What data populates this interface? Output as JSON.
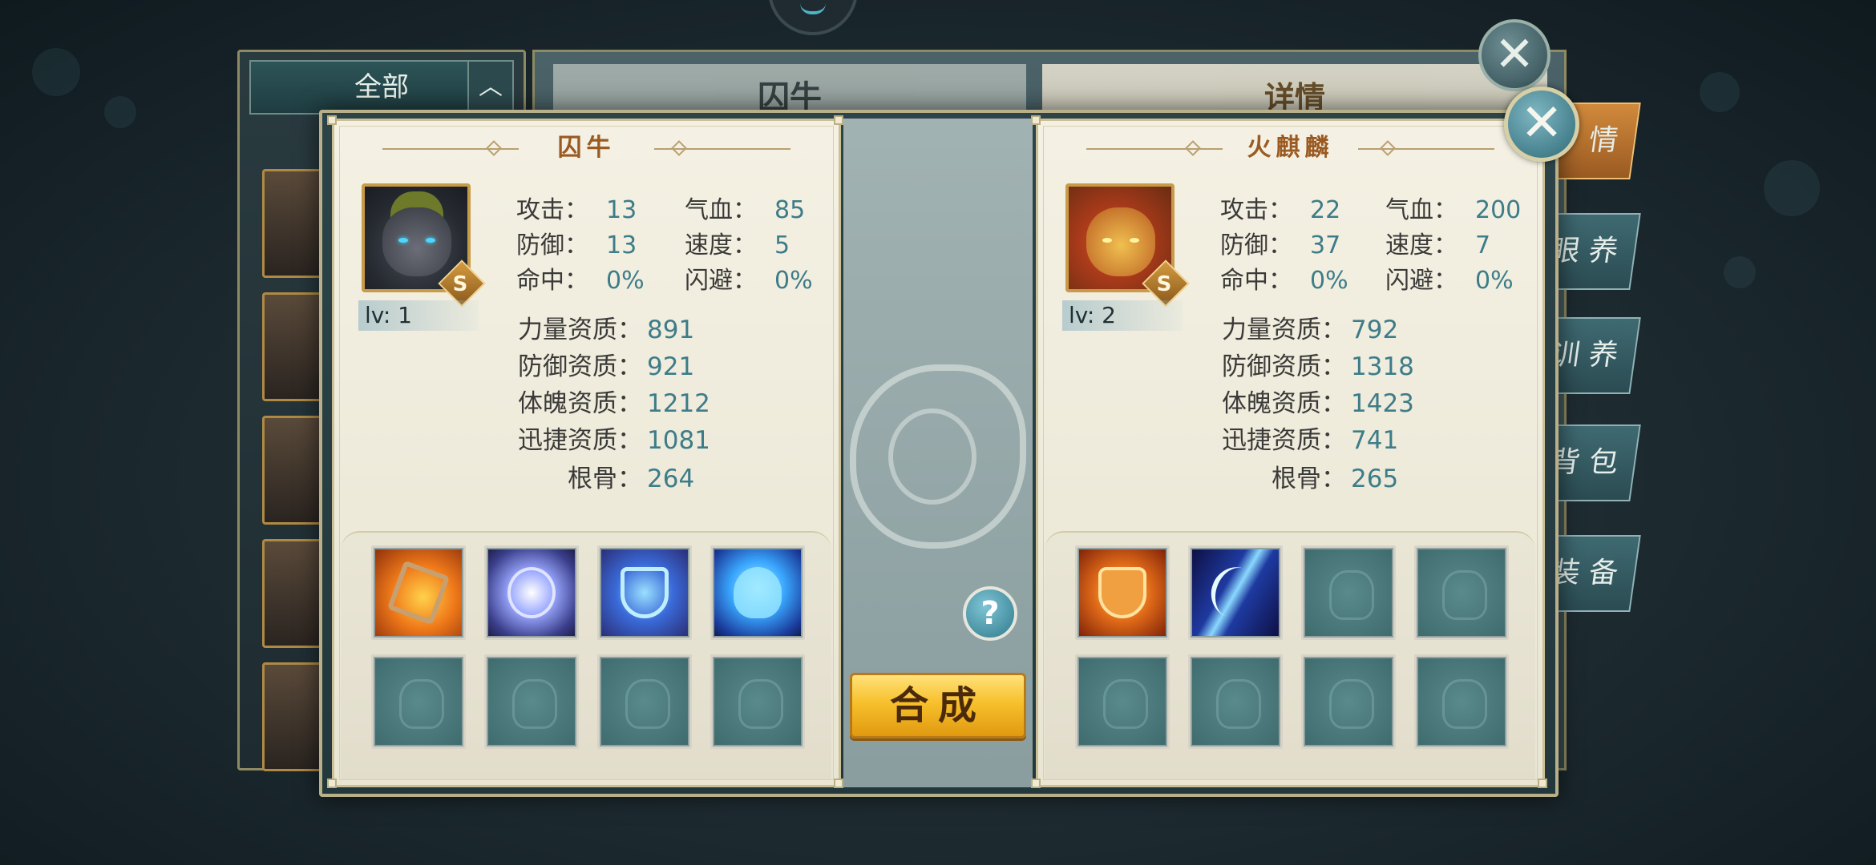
{
  "background": {
    "filter_label": "全部",
    "filter_arrow": "︿",
    "center_title": "囚牛",
    "detail_title": "详情",
    "side_tabs": [
      "情",
      "眼 养",
      "训 养",
      "背 包",
      "装 备"
    ]
  },
  "left_pet": {
    "name": "囚牛",
    "grade": "S",
    "level": "lv: 1",
    "stats": [
      {
        "label": "攻击：",
        "value": "13"
      },
      {
        "label": "气血：",
        "value": "85"
      },
      {
        "label": "防御：",
        "value": "13"
      },
      {
        "label": "速度：",
        "value": "5"
      },
      {
        "label": "命中：",
        "value": "0%"
      },
      {
        "label": "闪避：",
        "value": "0%"
      }
    ],
    "aptitudes": [
      {
        "label": "力量资质：",
        "value": "891"
      },
      {
        "label": "防御资质：",
        "value": "921"
      },
      {
        "label": "体魄资质：",
        "value": "1212"
      },
      {
        "label": "迅捷资质：",
        "value": "1081"
      },
      {
        "label": "根骨：",
        "value": "264"
      }
    ],
    "skills": [
      "fire-rune-skill-icon",
      "spirit-orb-skill-icon",
      "shield-skill-icon",
      "heart-skill-icon",
      "empty",
      "empty",
      "empty",
      "empty"
    ]
  },
  "right_pet": {
    "name": "火麒麟",
    "grade": "S",
    "level": "lv: 2",
    "stats": [
      {
        "label": "攻击：",
        "value": "22"
      },
      {
        "label": "气血：",
        "value": "200"
      },
      {
        "label": "防御：",
        "value": "37"
      },
      {
        "label": "速度：",
        "value": "7"
      },
      {
        "label": "命中：",
        "value": "0%"
      },
      {
        "label": "闪避：",
        "value": "0%"
      }
    ],
    "aptitudes": [
      {
        "label": "力量资质：",
        "value": "792"
      },
      {
        "label": "防御资质：",
        "value": "1318"
      },
      {
        "label": "体魄资质：",
        "value": "1423"
      },
      {
        "label": "迅捷资质：",
        "value": "741"
      },
      {
        "label": "根骨：",
        "value": "265"
      }
    ],
    "skills": [
      "flame-guard-skill-icon",
      "claw-slash-skill-icon",
      "empty",
      "empty",
      "empty",
      "empty",
      "empty",
      "empty"
    ]
  },
  "center": {
    "help_label": "?",
    "merge_label": "合成"
  },
  "icons": {
    "close": "✕"
  },
  "colors": {
    "accent_gold": "#f7c02c",
    "stat_value": "#3d7c88",
    "title_brown": "#9a5a22"
  }
}
